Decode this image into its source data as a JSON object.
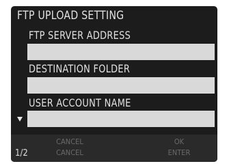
{
  "title": "FTP UPLOAD SETTING",
  "fields": [
    {
      "label": "FTP SERVER ADDRESS",
      "value": ""
    },
    {
      "label": "DESTINATION FOLDER",
      "value": ""
    },
    {
      "label": "USER ACCOUNT NAME",
      "value": ""
    }
  ],
  "scroll_indicator_icon": "scroll-down-arrow-icon",
  "footer": {
    "page": "1/2",
    "left_top": "CANCEL",
    "left_bottom": "CANCEL",
    "right_top": "OK",
    "right_bottom": "ENTER"
  }
}
